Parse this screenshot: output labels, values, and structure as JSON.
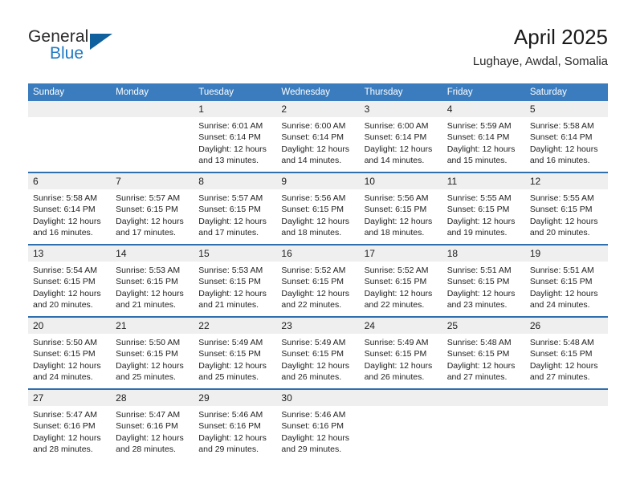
{
  "brand": {
    "name_part1": "General",
    "name_part2": "Blue",
    "triangle_color": "#10609e",
    "blue_text_color": "#1f7ac4"
  },
  "header": {
    "title": "April 2025",
    "subtitle": "Lughaye, Awdal, Somalia"
  },
  "theme": {
    "header_blue": "#3a7cbe",
    "rule_blue": "#2f6fae",
    "daynum_bg": "#efefef"
  },
  "calendar": {
    "weekday_headers": [
      "Sunday",
      "Monday",
      "Tuesday",
      "Wednesday",
      "Thursday",
      "Friday",
      "Saturday"
    ],
    "weeks": [
      [
        {
          "day": "",
          "sunrise": "",
          "sunset": "",
          "daylight_line1": "",
          "daylight_line2": ""
        },
        {
          "day": "",
          "sunrise": "",
          "sunset": "",
          "daylight_line1": "",
          "daylight_line2": ""
        },
        {
          "day": "1",
          "sunrise": "Sunrise: 6:01 AM",
          "sunset": "Sunset: 6:14 PM",
          "daylight_line1": "Daylight: 12 hours",
          "daylight_line2": "and 13 minutes."
        },
        {
          "day": "2",
          "sunrise": "Sunrise: 6:00 AM",
          "sunset": "Sunset: 6:14 PM",
          "daylight_line1": "Daylight: 12 hours",
          "daylight_line2": "and 14 minutes."
        },
        {
          "day": "3",
          "sunrise": "Sunrise: 6:00 AM",
          "sunset": "Sunset: 6:14 PM",
          "daylight_line1": "Daylight: 12 hours",
          "daylight_line2": "and 14 minutes."
        },
        {
          "day": "4",
          "sunrise": "Sunrise: 5:59 AM",
          "sunset": "Sunset: 6:14 PM",
          "daylight_line1": "Daylight: 12 hours",
          "daylight_line2": "and 15 minutes."
        },
        {
          "day": "5",
          "sunrise": "Sunrise: 5:58 AM",
          "sunset": "Sunset: 6:14 PM",
          "daylight_line1": "Daylight: 12 hours",
          "daylight_line2": "and 16 minutes."
        }
      ],
      [
        {
          "day": "6",
          "sunrise": "Sunrise: 5:58 AM",
          "sunset": "Sunset: 6:14 PM",
          "daylight_line1": "Daylight: 12 hours",
          "daylight_line2": "and 16 minutes."
        },
        {
          "day": "7",
          "sunrise": "Sunrise: 5:57 AM",
          "sunset": "Sunset: 6:15 PM",
          "daylight_line1": "Daylight: 12 hours",
          "daylight_line2": "and 17 minutes."
        },
        {
          "day": "8",
          "sunrise": "Sunrise: 5:57 AM",
          "sunset": "Sunset: 6:15 PM",
          "daylight_line1": "Daylight: 12 hours",
          "daylight_line2": "and 17 minutes."
        },
        {
          "day": "9",
          "sunrise": "Sunrise: 5:56 AM",
          "sunset": "Sunset: 6:15 PM",
          "daylight_line1": "Daylight: 12 hours",
          "daylight_line2": "and 18 minutes."
        },
        {
          "day": "10",
          "sunrise": "Sunrise: 5:56 AM",
          "sunset": "Sunset: 6:15 PM",
          "daylight_line1": "Daylight: 12 hours",
          "daylight_line2": "and 18 minutes."
        },
        {
          "day": "11",
          "sunrise": "Sunrise: 5:55 AM",
          "sunset": "Sunset: 6:15 PM",
          "daylight_line1": "Daylight: 12 hours",
          "daylight_line2": "and 19 minutes."
        },
        {
          "day": "12",
          "sunrise": "Sunrise: 5:55 AM",
          "sunset": "Sunset: 6:15 PM",
          "daylight_line1": "Daylight: 12 hours",
          "daylight_line2": "and 20 minutes."
        }
      ],
      [
        {
          "day": "13",
          "sunrise": "Sunrise: 5:54 AM",
          "sunset": "Sunset: 6:15 PM",
          "daylight_line1": "Daylight: 12 hours",
          "daylight_line2": "and 20 minutes."
        },
        {
          "day": "14",
          "sunrise": "Sunrise: 5:53 AM",
          "sunset": "Sunset: 6:15 PM",
          "daylight_line1": "Daylight: 12 hours",
          "daylight_line2": "and 21 minutes."
        },
        {
          "day": "15",
          "sunrise": "Sunrise: 5:53 AM",
          "sunset": "Sunset: 6:15 PM",
          "daylight_line1": "Daylight: 12 hours",
          "daylight_line2": "and 21 minutes."
        },
        {
          "day": "16",
          "sunrise": "Sunrise: 5:52 AM",
          "sunset": "Sunset: 6:15 PM",
          "daylight_line1": "Daylight: 12 hours",
          "daylight_line2": "and 22 minutes."
        },
        {
          "day": "17",
          "sunrise": "Sunrise: 5:52 AM",
          "sunset": "Sunset: 6:15 PM",
          "daylight_line1": "Daylight: 12 hours",
          "daylight_line2": "and 22 minutes."
        },
        {
          "day": "18",
          "sunrise": "Sunrise: 5:51 AM",
          "sunset": "Sunset: 6:15 PM",
          "daylight_line1": "Daylight: 12 hours",
          "daylight_line2": "and 23 minutes."
        },
        {
          "day": "19",
          "sunrise": "Sunrise: 5:51 AM",
          "sunset": "Sunset: 6:15 PM",
          "daylight_line1": "Daylight: 12 hours",
          "daylight_line2": "and 24 minutes."
        }
      ],
      [
        {
          "day": "20",
          "sunrise": "Sunrise: 5:50 AM",
          "sunset": "Sunset: 6:15 PM",
          "daylight_line1": "Daylight: 12 hours",
          "daylight_line2": "and 24 minutes."
        },
        {
          "day": "21",
          "sunrise": "Sunrise: 5:50 AM",
          "sunset": "Sunset: 6:15 PM",
          "daylight_line1": "Daylight: 12 hours",
          "daylight_line2": "and 25 minutes."
        },
        {
          "day": "22",
          "sunrise": "Sunrise: 5:49 AM",
          "sunset": "Sunset: 6:15 PM",
          "daylight_line1": "Daylight: 12 hours",
          "daylight_line2": "and 25 minutes."
        },
        {
          "day": "23",
          "sunrise": "Sunrise: 5:49 AM",
          "sunset": "Sunset: 6:15 PM",
          "daylight_line1": "Daylight: 12 hours",
          "daylight_line2": "and 26 minutes."
        },
        {
          "day": "24",
          "sunrise": "Sunrise: 5:49 AM",
          "sunset": "Sunset: 6:15 PM",
          "daylight_line1": "Daylight: 12 hours",
          "daylight_line2": "and 26 minutes."
        },
        {
          "day": "25",
          "sunrise": "Sunrise: 5:48 AM",
          "sunset": "Sunset: 6:15 PM",
          "daylight_line1": "Daylight: 12 hours",
          "daylight_line2": "and 27 minutes."
        },
        {
          "day": "26",
          "sunrise": "Sunrise: 5:48 AM",
          "sunset": "Sunset: 6:15 PM",
          "daylight_line1": "Daylight: 12 hours",
          "daylight_line2": "and 27 minutes."
        }
      ],
      [
        {
          "day": "27",
          "sunrise": "Sunrise: 5:47 AM",
          "sunset": "Sunset: 6:16 PM",
          "daylight_line1": "Daylight: 12 hours",
          "daylight_line2": "and 28 minutes."
        },
        {
          "day": "28",
          "sunrise": "Sunrise: 5:47 AM",
          "sunset": "Sunset: 6:16 PM",
          "daylight_line1": "Daylight: 12 hours",
          "daylight_line2": "and 28 minutes."
        },
        {
          "day": "29",
          "sunrise": "Sunrise: 5:46 AM",
          "sunset": "Sunset: 6:16 PM",
          "daylight_line1": "Daylight: 12 hours",
          "daylight_line2": "and 29 minutes."
        },
        {
          "day": "30",
          "sunrise": "Sunrise: 5:46 AM",
          "sunset": "Sunset: 6:16 PM",
          "daylight_line1": "Daylight: 12 hours",
          "daylight_line2": "and 29 minutes."
        },
        {
          "day": "",
          "sunrise": "",
          "sunset": "",
          "daylight_line1": "",
          "daylight_line2": ""
        },
        {
          "day": "",
          "sunrise": "",
          "sunset": "",
          "daylight_line1": "",
          "daylight_line2": ""
        },
        {
          "day": "",
          "sunrise": "",
          "sunset": "",
          "daylight_line1": "",
          "daylight_line2": ""
        }
      ]
    ]
  }
}
